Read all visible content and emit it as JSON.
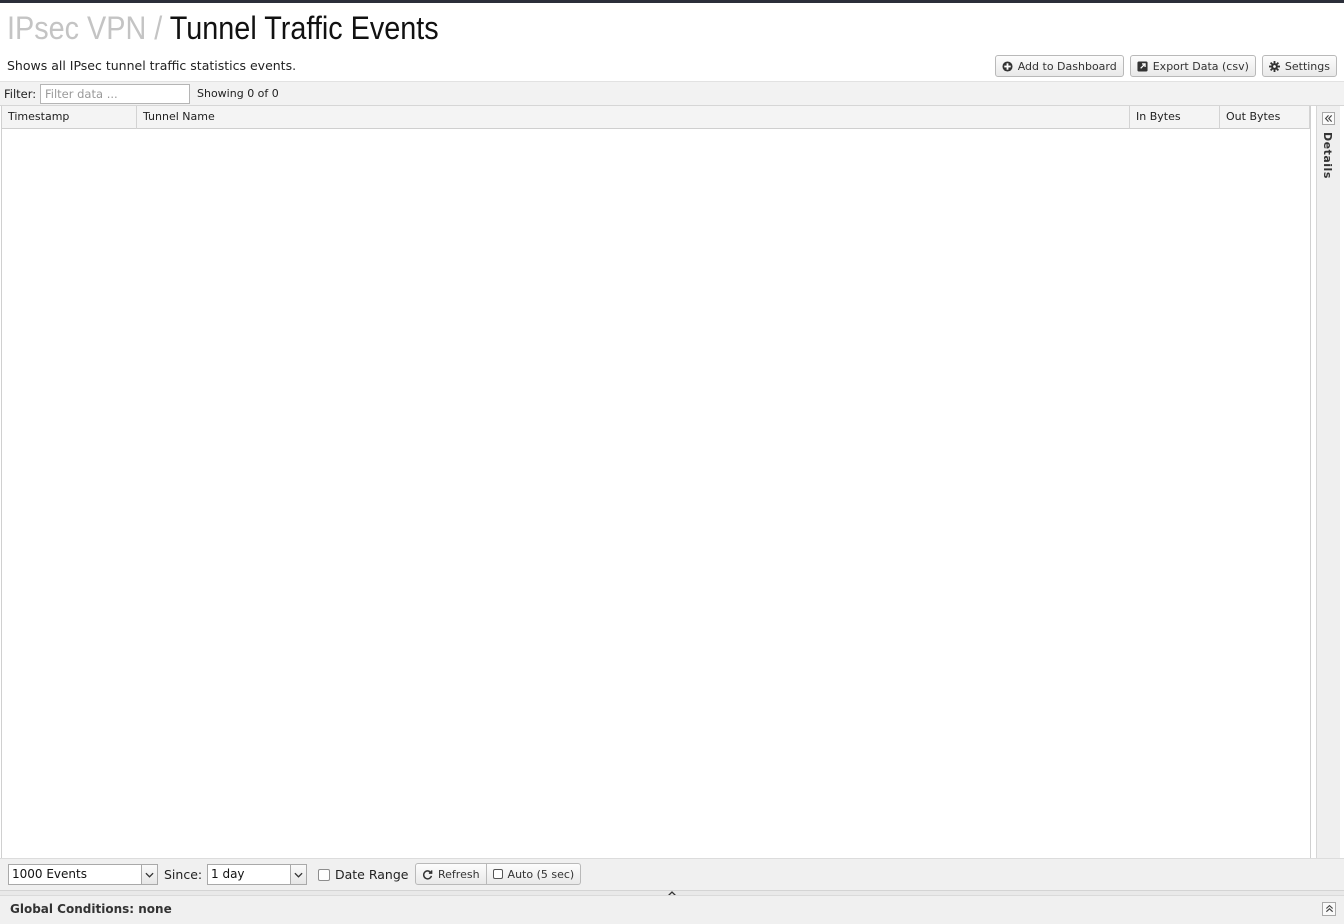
{
  "header": {
    "breadcrumb": "IPsec VPN",
    "separator": "/",
    "title": "Tunnel Traffic Events",
    "description": "Shows all IPsec tunnel traffic statistics events."
  },
  "actions": {
    "add_dashboard": "Add to Dashboard",
    "export": "Export Data (csv)",
    "settings": "Settings"
  },
  "filter": {
    "label": "Filter:",
    "placeholder": "Filter data ...",
    "value": "",
    "showing": "Showing 0 of 0"
  },
  "grid": {
    "columns": [
      "Timestamp",
      "Tunnel Name",
      "In Bytes",
      "Out Bytes"
    ],
    "rows": []
  },
  "details": {
    "label": "Details"
  },
  "bottombar": {
    "limit": "1000 Events",
    "since_label": "Since:",
    "since": "1 day",
    "date_range_label": "Date Range",
    "date_range_checked": false,
    "refresh": "Refresh",
    "auto": "Auto (5 sec)"
  },
  "conditions": {
    "text": "Global Conditions: none"
  },
  "icons": {
    "add_dashboard": "plus-circle-icon",
    "export": "external-link-icon",
    "settings": "gear-icon",
    "refresh": "refresh-icon",
    "auto": "square-icon",
    "details_toggle": "double-chevron-left-icon",
    "conditions_toggle": "double-chevron-up-icon",
    "splitter": "chevron-up-icon"
  }
}
